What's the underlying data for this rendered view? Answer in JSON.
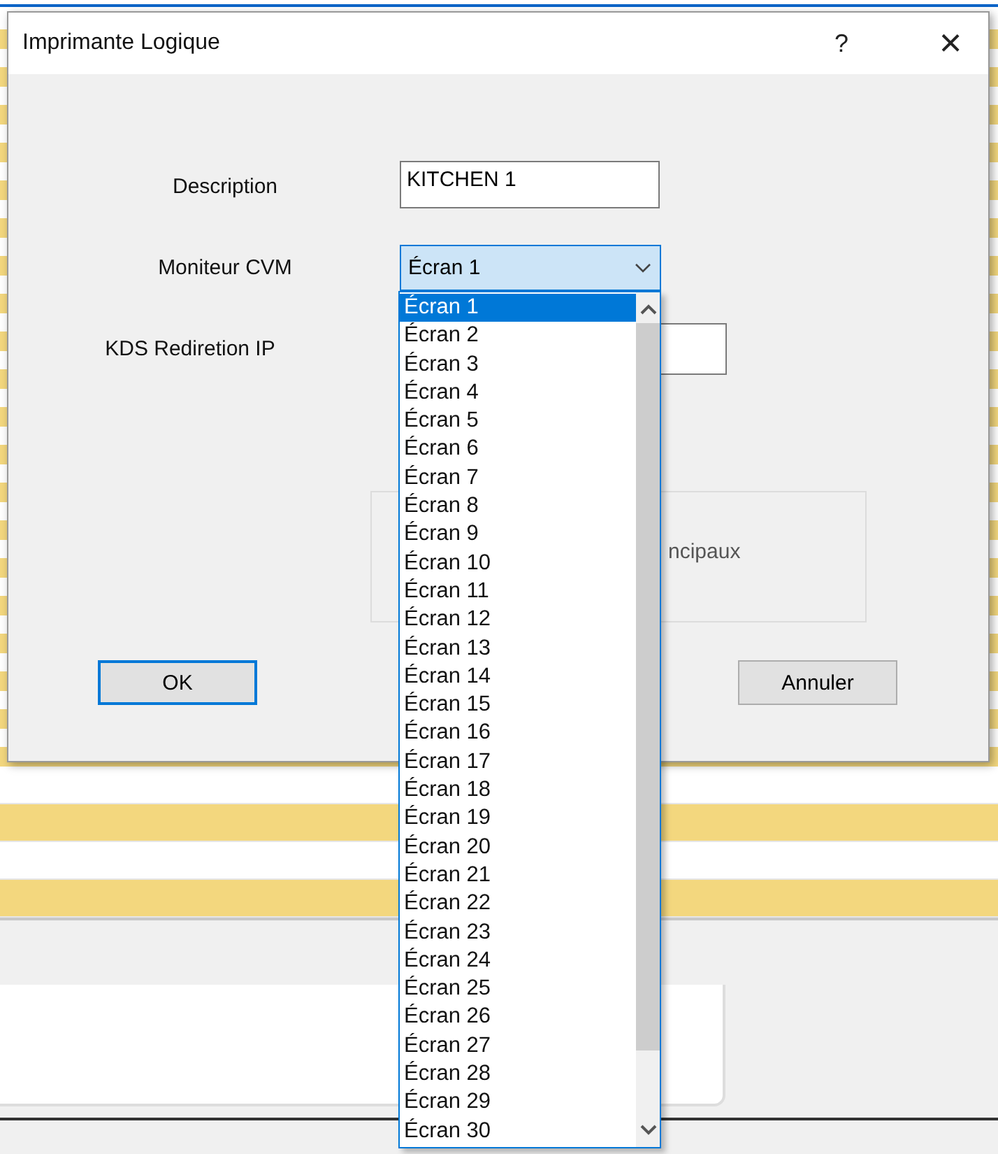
{
  "background_table": {
    "rows": [
      {
        "highlighted": false
      },
      {
        "highlighted": true
      },
      {
        "highlighted": false
      },
      {
        "highlighted": true
      }
    ]
  },
  "dialog": {
    "title": "Imprimante Logique",
    "help": "?",
    "close": "×",
    "fields": [
      {
        "kind": "text",
        "label": "Description",
        "value": "KITCHEN 1"
      },
      {
        "kind": "combo",
        "label": "Moniteur CVM",
        "value": "Écran 1"
      },
      {
        "kind": "text",
        "label": "KDS Rediretion IP"
      }
    ],
    "group_text": "ncipaux",
    "buttons": [
      {
        "label": "OK",
        "default": true
      },
      {
        "label": "Annuler",
        "default": false
      }
    ]
  },
  "dropdown": {
    "items": [
      {
        "label": "Écran 1",
        "selected": true
      },
      {
        "label": "Écran 2",
        "selected": false
      },
      {
        "label": "Écran 3",
        "selected": false
      },
      {
        "label": "Écran 4",
        "selected": false
      },
      {
        "label": "Écran 5",
        "selected": false
      },
      {
        "label": "Écran 6",
        "selected": false
      },
      {
        "label": "Écran 7",
        "selected": false
      },
      {
        "label": "Écran 8",
        "selected": false
      },
      {
        "label": "Écran 9",
        "selected": false
      },
      {
        "label": "Écran 10",
        "selected": false
      },
      {
        "label": "Écran 11",
        "selected": false
      },
      {
        "label": "Écran 12",
        "selected": false
      },
      {
        "label": "Écran 13",
        "selected": false
      },
      {
        "label": "Écran 14",
        "selected": false
      },
      {
        "label": "Écran 15",
        "selected": false
      },
      {
        "label": "Écran 16",
        "selected": false
      },
      {
        "label": "Écran 17",
        "selected": false
      },
      {
        "label": "Écran 18",
        "selected": false
      },
      {
        "label": "Écran 19",
        "selected": false
      },
      {
        "label": "Écran 20",
        "selected": false
      },
      {
        "label": "Écran 21",
        "selected": false
      },
      {
        "label": "Écran 22",
        "selected": false
      },
      {
        "label": "Écran 23",
        "selected": false
      },
      {
        "label": "Écran 24",
        "selected": false
      },
      {
        "label": "Écran 25",
        "selected": false
      },
      {
        "label": "Écran 26",
        "selected": false
      },
      {
        "label": "Écran 27",
        "selected": false
      },
      {
        "label": "Écran 28",
        "selected": false
      },
      {
        "label": "Écran 29",
        "selected": false
      },
      {
        "label": "Écran 30",
        "selected": false
      }
    ]
  }
}
